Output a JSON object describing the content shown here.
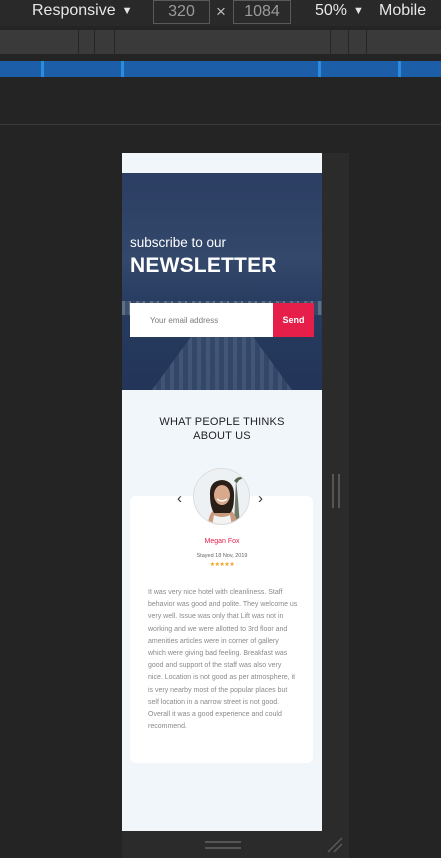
{
  "toolbar": {
    "device_mode": "Responsive",
    "width": "320",
    "times": "×",
    "height": "1084",
    "zoom": "50%",
    "throttle": "Mobile"
  },
  "newsletter": {
    "subtitle": "subscribe to our",
    "title": "NEWSLETTER",
    "email_placeholder": "Your email address",
    "send_label": "Send"
  },
  "testimonials": {
    "title": "WHAT PEOPLE THINKS ABOUT US",
    "prev_icon": "‹",
    "next_icon": "›",
    "name": "Megan Fox",
    "stayed": "Stayed 18 Nov, 2019",
    "stars": "★★★★★",
    "rating": 5,
    "review": "It was very nice hotel with cleanliness. Staff behavior was good and polite. They welcome us very well. Issue was only that Lift was not in working and we were allotted to 3rd floor and amenities articles were in corner of gallery which were giving bad feeling. Breakfast was good and support of the staff was also very nice. Location is not good as per atmosphere, it is very nearby most of the popular places but self location in a narrow street is not good. Overall it was a good experience and could recommend."
  },
  "colors": {
    "accent": "#e51e4a",
    "star": "#f0a020",
    "page_bg": "#f1f6fb",
    "devtools_bg": "#242424",
    "media_query_bar": "#1c5ea8"
  }
}
